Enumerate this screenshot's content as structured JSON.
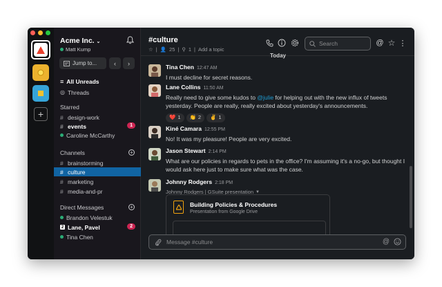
{
  "colors": {
    "accent_selected": "#1164a3",
    "badge": "#cd2553",
    "mention": "#1d9bd1",
    "presence_online": "#2bac76",
    "traffic_close": "#ff5f57",
    "traffic_min": "#febc2e",
    "traffic_max": "#28c840"
  },
  "workspaces": [
    {
      "icon": "warning-triangle-icon",
      "color": "#e8412e",
      "active": true
    },
    {
      "icon": "circle-icon",
      "color": "#ecb22e",
      "active": false
    },
    {
      "icon": "square-icon",
      "color": "#36a4d8",
      "active": false
    }
  ],
  "sidebar": {
    "workspace_name": "Acme Inc.",
    "user_name": "Matt Kump",
    "jump_to_label": "Jump to...",
    "all_unreads": "All Unreads",
    "threads": "Threads",
    "starred_header": "Starred",
    "starred": [
      {
        "type": "channel",
        "name": "design-work",
        "bold": false
      },
      {
        "type": "channel",
        "name": "events",
        "bold": true,
        "badge": "1"
      },
      {
        "type": "dm",
        "name": "Caroline McCarthy",
        "bold": false
      }
    ],
    "channels_header": "Channels",
    "channels": [
      {
        "name": "brainstorming",
        "selected": false
      },
      {
        "name": "culture",
        "selected": true
      },
      {
        "name": "marketing",
        "selected": false
      },
      {
        "name": "media-and-pr",
        "selected": false
      }
    ],
    "dm_header": "Direct Messages",
    "dms": [
      {
        "name": "Brandon Velestuk",
        "bold": false,
        "kind": "online"
      },
      {
        "name": "Lane, Pavel",
        "bold": true,
        "kind": "group",
        "group_count": "2",
        "badge": "2"
      },
      {
        "name": "Tina Chen",
        "bold": false,
        "kind": "online"
      }
    ]
  },
  "header": {
    "channel": "#culture",
    "members": "25",
    "pins": "1",
    "add_topic": "Add a topic",
    "search_placeholder": "Search",
    "date_divider": "Today"
  },
  "messages": [
    {
      "author": "Tina Chen",
      "time": "12:47 AM",
      "text": "I must decline for secret reasons."
    },
    {
      "author": "Lane Collins",
      "time": "11:50 AM",
      "text_pre": "Really need to give some kudos to ",
      "mention": "@julie",
      "text_post": " for helping out with the new influx of tweets yesterday. People are really, really excited about yesterday's announcements.",
      "reactions": [
        {
          "emoji": "❤️",
          "count": "1"
        },
        {
          "emoji": "👏",
          "count": "2"
        },
        {
          "emoji": "✌️",
          "count": "1"
        }
      ]
    },
    {
      "author": "Kiné Camara",
      "time": "12:55 PM",
      "text": "No! It was my pleasure! People are very excited."
    },
    {
      "author": "Jason Stewart",
      "time": "2:14 PM",
      "text": "What are our policies in regards to pets in the office? I'm assuming it's a no-go, but thought I would ask here just to make sure what was the case."
    },
    {
      "author": "Johnny Rodgers",
      "time": "2:18 PM",
      "subline": "Johnny Rodgers | GSuite presentation",
      "attachment": {
        "title": "Building Policies & Procedures",
        "subtitle": "Presentation from Google Drive"
      }
    }
  ],
  "composer": {
    "placeholder": "Message #culture"
  }
}
